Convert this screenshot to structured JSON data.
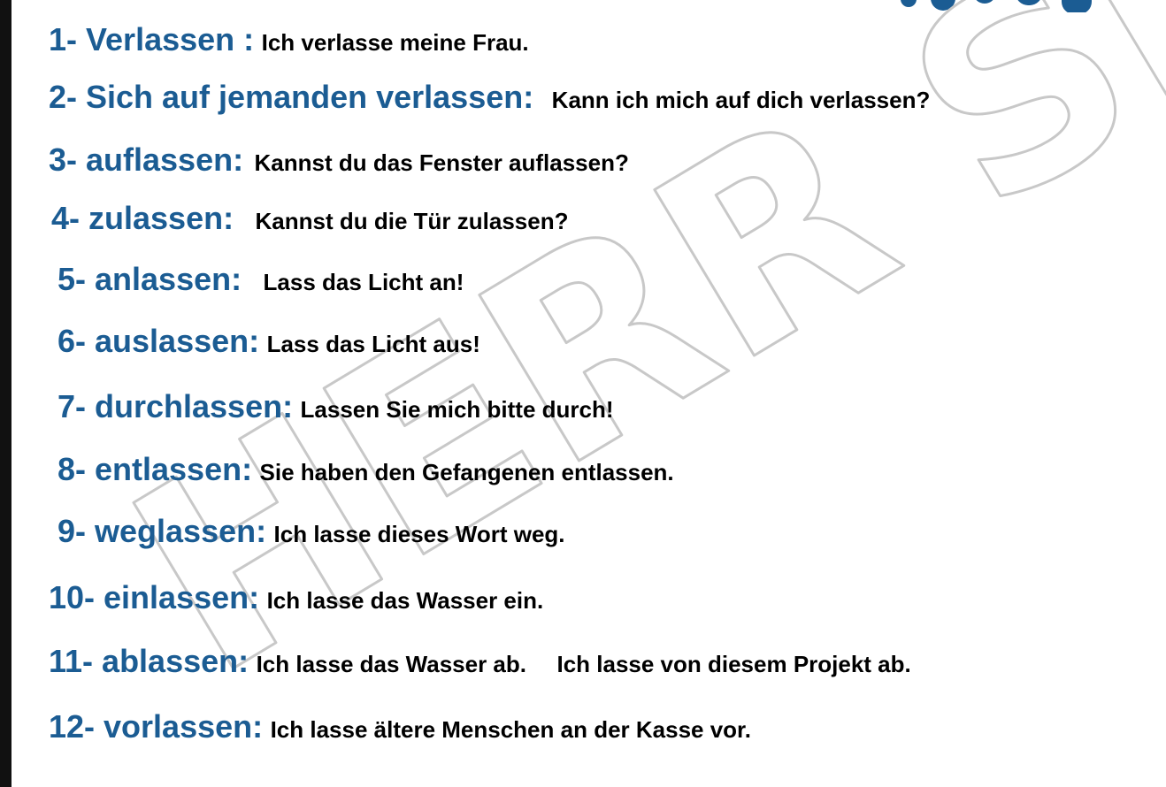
{
  "watermark": {
    "text": "HERR SIDD",
    "color": "#c8c8c8"
  },
  "colors": {
    "term": "#1b5c93",
    "example": "#000000"
  },
  "items": [
    {
      "term": "1- Verlassen  :",
      "example": "Ich verlasse meine Frau."
    },
    {
      "term": "2- Sich auf jemanden verlassen:",
      "example": "Kann ich mich auf dich verlassen?"
    },
    {
      "term": "3- auflassen:",
      "example": "Kannst du das Fenster auflassen?"
    },
    {
      "term": "4- zulassen:",
      "example": "Kannst du die Tür zulassen?"
    },
    {
      "term": "5- anlassen:",
      "example": "Lass das Licht an!"
    },
    {
      "term": "6- auslassen:",
      "example": "Lass das Licht aus!"
    },
    {
      "term": "7- durchlassen:",
      "example": "Lassen Sie mich bitte durch!"
    },
    {
      "term": "8- entlassen:",
      "example": "Sie haben den Gefangenen entlassen."
    },
    {
      "term": "9- weglassen:",
      "example": "Ich lasse dieses Wort weg."
    },
    {
      "term": "10- einlassen:",
      "example": "Ich lasse das Wasser ein."
    },
    {
      "term": "11- ablassen:",
      "example": "Ich lasse das Wasser ab.",
      "example2": "Ich lasse von diesem Projekt ab."
    },
    {
      "term": "12- vorlassen:",
      "example": "Ich lasse ältere Menschen an der Kasse vor."
    }
  ]
}
